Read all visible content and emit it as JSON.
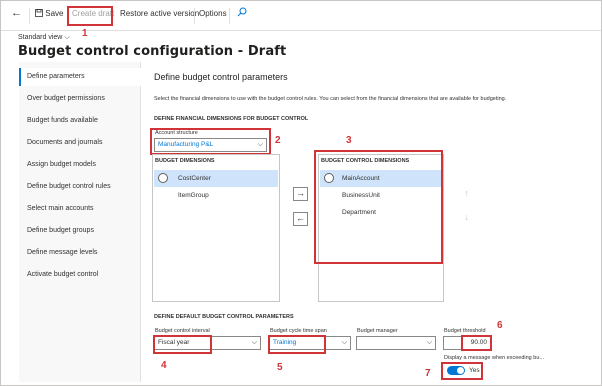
{
  "toolbar": {
    "save_label": "Save",
    "create_draft_label": "Create draft",
    "restore_label": "Restore active version",
    "options_label": "Options"
  },
  "view": {
    "label": "Standard view"
  },
  "page": {
    "title": "Budget control configuration - Draft"
  },
  "nav": {
    "items": [
      "Define parameters",
      "Over budget permissions",
      "Budget funds available",
      "Documents and journals",
      "Assign budget models",
      "Define budget control rules",
      "Select main accounts",
      "Define budget groups",
      "Define message levels",
      "Activate budget control"
    ]
  },
  "main": {
    "title": "Define budget control parameters",
    "description": "Select the financial dimensions to use with the budget control rules. You can select from the financial dimensions that are available for budgeting.",
    "dims_section": "DEFINE FINANCIAL DIMENSIONS FOR BUDGET CONTROL",
    "account_structure_label": "Account structure",
    "account_structure_value": "Manufacturing P&L",
    "budget_dims_header": "BUDGET DIMENSIONS",
    "budget_dims": [
      "CostCenter",
      "ItemGroup"
    ],
    "control_dims_header": "BUDGET CONTROL DIMENSIONS",
    "control_dims": [
      "MainAccount",
      "BusinessUnit",
      "Department"
    ],
    "defaults_section": "DEFINE DEFAULT BUDGET CONTROL PARAMETERS",
    "interval_label": "Budget control interval",
    "interval_value": "Fiscal year",
    "timespan_label": "Budget cycle time span",
    "timespan_value": "Training",
    "manager_label": "Budget manager",
    "manager_value": "",
    "threshold_label": "Budget threshold",
    "threshold_value": "90.00",
    "message_label": "Display a message when exceeding bu...",
    "message_toggle_value": "Yes"
  },
  "callouts": [
    "1",
    "2",
    "3",
    "4",
    "5",
    "6",
    "7"
  ],
  "colors": {
    "accent": "#0078d4",
    "highlight": "#d13438",
    "selected_row": "#cfe4fa"
  }
}
